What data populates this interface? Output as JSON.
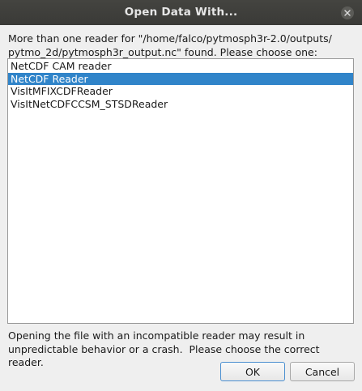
{
  "window": {
    "title": "Open Data With..."
  },
  "message": "More than one reader for \"/home/falco/pytmosph3r-2.0/outputs/\npytmo_2d/pytmosph3r_output.nc\" found. Please choose one:",
  "readers": [
    {
      "label": "NetCDF CAM reader",
      "selected": false
    },
    {
      "label": "NetCDF Reader",
      "selected": true
    },
    {
      "label": "VisItMFIXCDFReader",
      "selected": false
    },
    {
      "label": "VisItNetCDFCCSM_STSDReader",
      "selected": false
    }
  ],
  "warning": "Opening the file with an incompatible reader may result in\nunpredictable behavior or a crash.  Please choose the correct reader.",
  "buttons": {
    "ok_label": "OK",
    "cancel_label": "Cancel"
  }
}
